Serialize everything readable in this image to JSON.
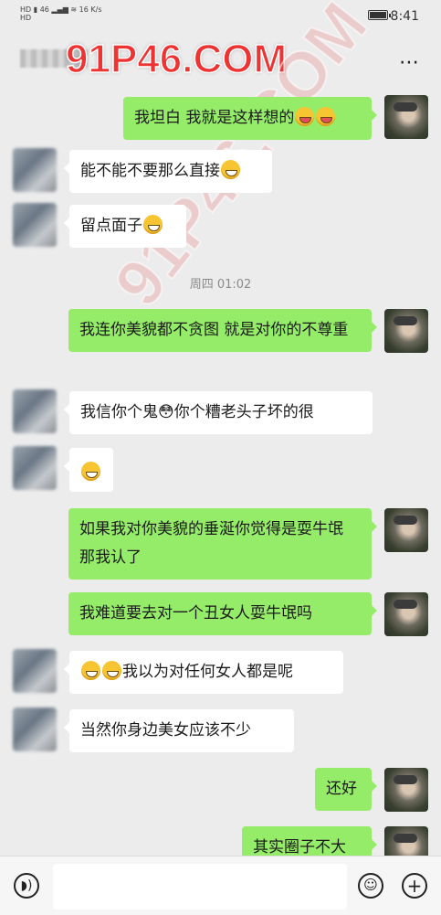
{
  "status_bar": {
    "left_labels": [
      "HD",
      "HD",
      "46",
      "16 K/s"
    ],
    "time": "8:41"
  },
  "header": {
    "more_icon": "⋯",
    "watermark": "91P46.COM"
  },
  "timestamp": "周四 01:02",
  "messages": [
    {
      "side": "right",
      "text": "我坦白 我就是这样想的",
      "emojis": [
        "tongue-wink",
        "tongue-wink"
      ]
    },
    {
      "side": "left",
      "text": "能不能不要那么直接",
      "emojis": [
        "grin"
      ]
    },
    {
      "side": "left",
      "text": "留点面子",
      "emojis": [
        "thinking"
      ]
    },
    {
      "side": "right",
      "text": "我连你美貌都不贪图 就是对你的不尊重"
    },
    {
      "side": "left",
      "text": "我信你个鬼😳你个糟老头子坏的很"
    },
    {
      "side": "left",
      "text": "",
      "emojis": [
        "wink"
      ]
    },
    {
      "side": "right",
      "text": "如果我对你美貌的垂涎你觉得是耍牛氓 那我认了"
    },
    {
      "side": "right",
      "text": "我难道要去对一个丑女人耍牛氓吗"
    },
    {
      "side": "left",
      "text": "我以为对任何女人都是呢",
      "emojis": [
        "grin",
        "grin"
      ]
    },
    {
      "side": "left",
      "text": "当然你身边美女应该不少"
    },
    {
      "side": "right",
      "text": "还好"
    },
    {
      "side": "right",
      "text": "其实圈子不大"
    }
  ],
  "bottom_bar": {
    "voice_icon": "voice-icon",
    "emoji_icon": "emoji-icon",
    "plus_icon": "plus-icon"
  },
  "colors": {
    "background": "#ececec",
    "bubble_right": "#95ec69",
    "bubble_left": "#ffffff",
    "watermark": "#e33333"
  }
}
